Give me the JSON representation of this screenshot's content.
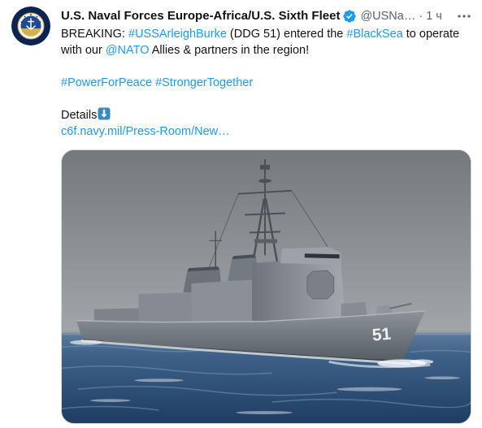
{
  "colors": {
    "text": "#0f1419",
    "secondary": "#536471",
    "link": "#1d9bf0",
    "verified": "#1d9bf0",
    "border": "#cfd9de"
  },
  "author": {
    "avatar_icon": "fleet-emblem-icon",
    "name": "U.S. Naval Forces Europe-Africa/U.S. Sixth Fleet",
    "verified_icon": "verified-badge-icon",
    "handle": "@USNa…",
    "separator": "·",
    "time": "1 ч"
  },
  "actions": {
    "more_icon": "more-horizontal-icon"
  },
  "tweet": {
    "line_1": {
      "text_a": "BREAKING: ",
      "hashtag_1": "#USSArleighBurke",
      "text_b": " (DDG 51) entered the ",
      "hashtag_2": "#BlackSea",
      "text_c": " to operate"
    },
    "line_2": {
      "text_a": "with our ",
      "mention": "@NATO",
      "text_b": " Allies & partners in the region!"
    },
    "hashtags": [
      "#PowerForPeace",
      "#StrongerTogether"
    ],
    "details_label": "Details",
    "details_icon": "down-arrow-emoji",
    "link_text": "c6f.navy.mil/Press-Room/New…"
  },
  "media": {
    "hull_number": "51"
  }
}
